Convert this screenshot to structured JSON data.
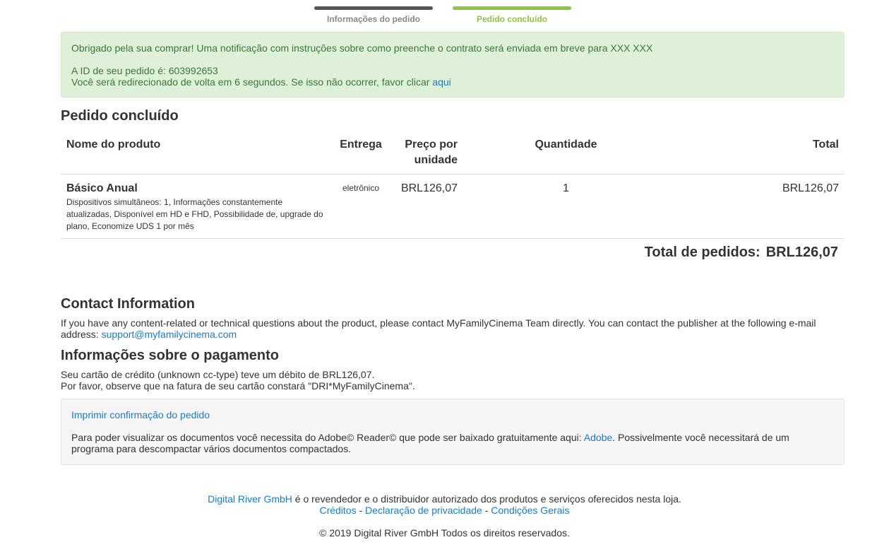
{
  "steps": [
    {
      "label": "Informações do pedido",
      "state": "done",
      "color": "#555555"
    },
    {
      "label": "Pedido concluído",
      "state": "active",
      "color": "#8cc63f"
    }
  ],
  "alert": {
    "thanks": "Obrigado pela sua comprar! Uma notificação com instruções sobre como preenche o contrato será enviada em breve para XXX XXX",
    "order_id_text": "A ID de seu pedido é: 603992653",
    "redirect_text": "Você será redirecionado de volta em 6 segundos. Se isso não ocorrer, favor clicar",
    "redirect_link": "aqui"
  },
  "order": {
    "title": "Pedido concluído",
    "columns": {
      "name": "Nome do produto",
      "delivery": "Entrega",
      "unit_price_line1": "Preço por",
      "unit_price_line2": "unidade",
      "quantity": "Quantidade",
      "total": "Total"
    },
    "items": [
      {
        "name": "Básico Anual",
        "description": "Dispositivos simultâneos: 1, Informações constantemente atualizadas, Disponível em HD e FHD, Possibilidade de, upgrade do plano, Economize UDS 1 por mês",
        "delivery": "eletrônico",
        "unit_price": "BRL126,07",
        "quantity": "1",
        "total": "BRL126,07"
      }
    ],
    "grand_total_label": "Total de pedidos:",
    "grand_total_value": "BRL126,07"
  },
  "contact": {
    "title": "Contact Information",
    "text": "If you have any content-related or technical questions about the product, please contact MyFamilyCinema Team directly. You can contact the publisher at the following e-mail address:",
    "email": "support@myfamilycinema.com"
  },
  "payment": {
    "title": "Informações sobre o pagamento",
    "line1": "Seu cartão de crédito (unknown cc-type) teve um débito de BRL126,07.",
    "line2": "Por favor, observe que na fatura de seu cartão constará \"DRI*MyFamilyCinema\"."
  },
  "print_box": {
    "print_link": "Imprimir confirmação do pedido",
    "text_before": "Para poder visualizar os documentos você necessita do Adobe© Reader© que pode ser baixado gratuitamente aqui:",
    "adobe_link": "Adobe",
    "text_after": ". Possivelmente você necessitará de um programa para descompactar vários documentos compactados."
  },
  "footer": {
    "company_link": "Digital River GmbH",
    "reseller_text": " é o revendedor e o distribuidor autorizado dos produtos e serviços oferecidos nesta loja.",
    "credits_link": "Créditos",
    "separator": " - ",
    "privacy_link": "Declaração de privacidade",
    "terms_link": "Condições Gerais",
    "copyright": "© 2019 Digital River GmbH Todos os direitos reservados."
  },
  "colors": {
    "link": "#1a7dc4",
    "alert_bg": "#dff0d8",
    "alert_text": "#3c763d",
    "step_done": "#555555",
    "step_active": "#8cc63f"
  }
}
